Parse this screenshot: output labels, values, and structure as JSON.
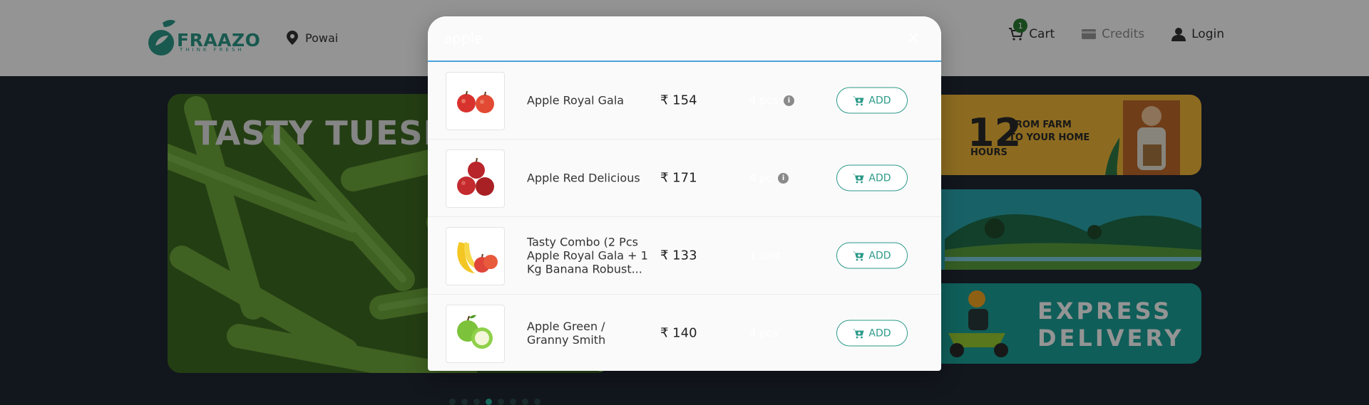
{
  "header": {
    "brand": "FRAAZO",
    "tagline": "THINK FRESH",
    "location": "Powai",
    "cart_label": "Cart",
    "cart_count": "1",
    "credits_label": "Credits",
    "login_label": "Login"
  },
  "hero": {
    "title": "TASTY TUESD"
  },
  "side_cards": {
    "hours_number": "12",
    "hours_label": "HOURS",
    "farm_text": "FROM FARM\nTO YOUR HOME",
    "express_text": "EXPRESS\nDELIVERY"
  },
  "carousel": {
    "dots": 8,
    "active_index": 3
  },
  "search": {
    "value": "apple",
    "close_label": "×"
  },
  "results": [
    {
      "name": "Apple Royal Gala",
      "price": "₹ 154",
      "qty": "4 pcs",
      "has_info": true,
      "add_label": "ADD",
      "icon": "red-apples-icon"
    },
    {
      "name": "Apple Red Delicious",
      "price": "₹ 171",
      "qty": "4 pc",
      "has_info": true,
      "add_label": "ADD",
      "icon": "red-delicious-apples-icon"
    },
    {
      "name": "Tasty Combo (2 Pcs Apple Royal Gala + 1 Kg Banana Robust...",
      "price": "₹ 133",
      "qty": "1 unit",
      "has_info": false,
      "add_label": "ADD",
      "icon": "banana-apple-combo-icon"
    },
    {
      "name": "Apple Green / Granny Smith",
      "price": "₹ 140",
      "qty": "4 pcs",
      "has_info": false,
      "add_label": "ADD",
      "icon": "green-apples-icon"
    }
  ],
  "colors": {
    "brand_green": "#2b9a88",
    "search_underline": "#4aa3df",
    "overlay": "rgba(0,0,0,0.42)"
  }
}
